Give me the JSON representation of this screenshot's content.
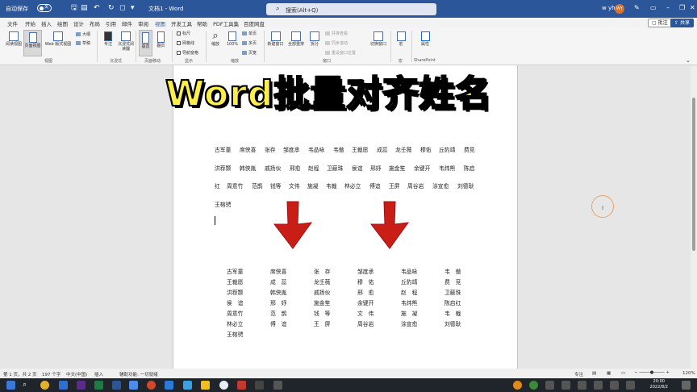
{
  "titlebar": {
    "autosave_label": "自动保存",
    "toggle_state": "关",
    "doc_title": "文档1 - Word",
    "search_placeholder": "搜索(Alt+Q)",
    "user_name": "w yh",
    "user_initials": "WY"
  },
  "tabs": [
    "文件",
    "开始",
    "插入",
    "绘图",
    "设计",
    "布局",
    "引用",
    "邮件",
    "审阅",
    "视图",
    "开发工具",
    "帮助",
    "PDF工具集",
    "百度网盘"
  ],
  "active_tab": "视图",
  "tab_actions": {
    "comments": "批注",
    "share": "共享"
  },
  "ribbon": {
    "views": [
      "阅读视图",
      "页面视图",
      "Web 版式视图"
    ],
    "outline": "大纲",
    "draft": "草稿",
    "immersive": [
      "专注",
      "沉浸式阅读器"
    ],
    "page_move": [
      "垂直",
      "翻页"
    ],
    "show": [
      "标尺",
      "网格线",
      "导航窗格"
    ],
    "zoom": [
      "缩放",
      "100%"
    ],
    "page_options": [
      "单页",
      "多页",
      "页宽"
    ],
    "window": [
      "新建窗口",
      "全部重排",
      "拆分"
    ],
    "window_disabled": [
      "并排查看",
      "同步滚动",
      "重设窗口位置"
    ],
    "switch_window": "切换窗口",
    "macro": "宏",
    "properties": "属性",
    "groups": [
      "视图",
      "沉浸式",
      "页面移动",
      "显示",
      "缩放",
      "窗口",
      "宏",
      "SharePoint"
    ]
  },
  "banner": "Word批量对齐姓名",
  "doc_rows_top": [
    [
      "古军童",
      "席侠喜",
      "张存",
      "邹度承",
      "韦品咏",
      "韦傲",
      "王裁愿",
      "成蕊",
      "龙壬薇",
      "穆佑",
      "丘豹靖",
      "费竞"
    ],
    [
      "洪荐颢",
      "韩侠胤",
      "戚扬伙",
      "邢愈",
      "赵程",
      "卫蔽珠",
      "侯谊",
      "邢妤",
      "施金笙",
      "余键开",
      "韦炜熊",
      "陈启"
    ],
    [
      "红",
      "周意竹",
      "范鹊",
      "钱等",
      "文伟",
      "施凝",
      "韦裁",
      "林必立",
      "傅谊",
      "王屏",
      "周谷岩",
      "涂宣愈",
      "刘德耿"
    ],
    [
      "王榕骋"
    ]
  ],
  "doc_table": [
    [
      "古军童",
      "席侠喜",
      "张　存",
      "邹度承",
      "韦品咏",
      "韦　傲"
    ],
    [
      "王裁愿",
      "成　蕊",
      "龙壬薇",
      "穆　佑",
      "丘豹靖",
      "费　竞"
    ],
    [
      "洪荐颢",
      "韩侠胤",
      "戚扬伙",
      "邢　愈",
      "赵　程",
      "卫蔽珠"
    ],
    [
      "侯　谊",
      "邢　妤",
      "施金笙",
      "余键开",
      "韦炜熊",
      "陈启红"
    ],
    [
      "周意竹",
      "范　鹊",
      "钱　等",
      "文　伟",
      "施　凝",
      "韦　裁"
    ],
    [
      "林必立",
      "傅　谊",
      "王　屏",
      "周谷岩",
      "涂宣愈",
      "刘德耿"
    ],
    [
      "王榕骋"
    ]
  ],
  "statusbar": {
    "page": "第 1 页，共 2 页",
    "words": "197 个字",
    "lang": "中文(中国)",
    "mode": "插入",
    "accessibility": "辅助功能: 一切就绪",
    "focus": "专注",
    "zoom": "120%"
  },
  "clock": {
    "time": "20:00",
    "date": "2022/8/2"
  },
  "colors": {
    "word_blue": "#2b579a",
    "banner_yellow": "#fcef4c",
    "arrow_red": "#c81e16"
  }
}
